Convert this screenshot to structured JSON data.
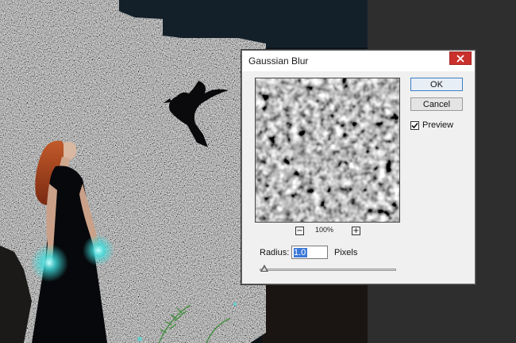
{
  "dialog": {
    "title": "Gaussian Blur",
    "ok_label": "OK",
    "cancel_label": "Cancel",
    "preview_label": "Preview",
    "preview_checked": true,
    "zoom_level": "100%",
    "zoom_out_symbol": "−",
    "zoom_in_symbol": "+",
    "radius_label": "Radius:",
    "radius_value": "1.0",
    "radius_unit": "Pixels",
    "close_icon": "close-icon"
  },
  "colors": {
    "close_button": "#c9302c",
    "selection": "#3b78d8",
    "glow": "#3fe0e0"
  }
}
